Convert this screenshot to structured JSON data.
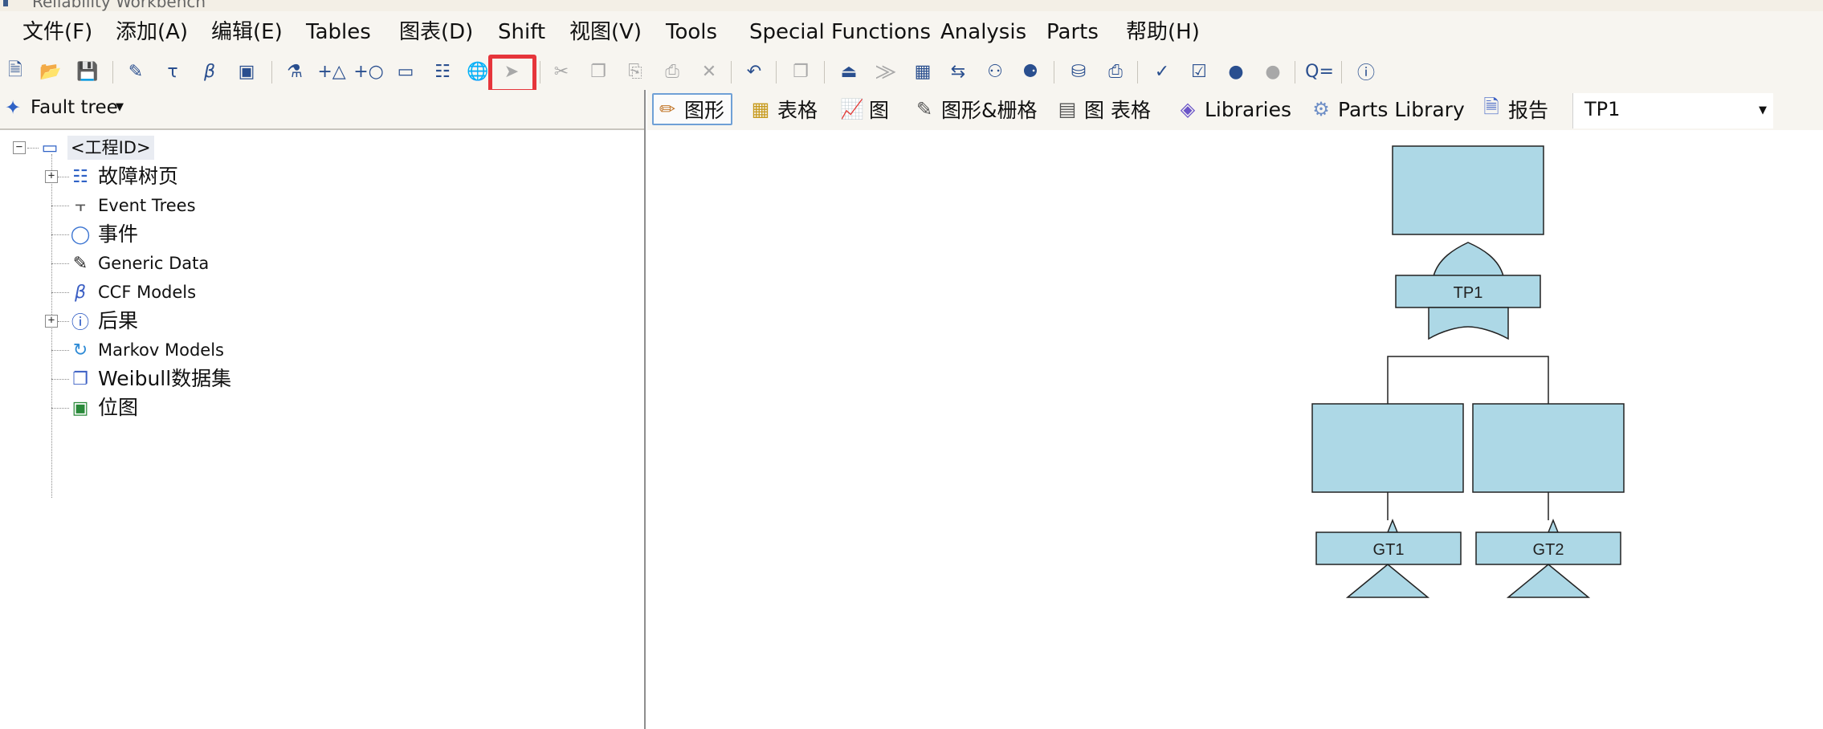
{
  "window": {
    "title": "Reliability Workbench"
  },
  "menu": [
    "文件(F)",
    "添加(A)",
    "编辑(E)",
    "Tables",
    "图表(D)",
    "Shift",
    "视图(V)",
    "Tools",
    "Special Functions",
    "Analysis",
    "Parts",
    "帮助(H)"
  ],
  "left_panel": {
    "view_selector": "Fault tree",
    "tree": [
      {
        "label": "<工程ID>"
      },
      {
        "label": "故障树页"
      },
      {
        "label": "Event Trees"
      },
      {
        "label": "事件"
      },
      {
        "label": "Generic Data"
      },
      {
        "label": "CCF Models"
      },
      {
        "label": "后果"
      },
      {
        "label": "Markov Models"
      },
      {
        "label": "Weibull数据集"
      },
      {
        "label": "位图"
      }
    ]
  },
  "right_panel": {
    "tabs": [
      "图形",
      "表格",
      "图",
      "图形&栅格",
      "图 表格",
      "Libraries",
      "Parts Library",
      "报告"
    ],
    "page_selector": "TP1"
  },
  "diagram": {
    "top_gate": {
      "label": "TP1"
    },
    "child_gates": [
      {
        "label": "GT1"
      },
      {
        "label": "GT2"
      }
    ],
    "fill": "#add8e6",
    "stroke": "#222222"
  },
  "colors": {
    "highlight": "#e6353b",
    "accent": "#2a4f8f"
  },
  "toolbar_icons": [
    "new-project-icon",
    "open-folder-icon",
    "save-icon",
    "edit-data-icon",
    "tau-icon",
    "beta-icon",
    "image-icon",
    "flask-icon",
    "add-gate-icon",
    "add-event-icon",
    "text-box-icon",
    "map-icon",
    "globe-icon",
    "pointer-arrow-icon",
    "cut-icon",
    "copy-icon",
    "paste-icon",
    "paste-special-icon",
    "delete-icon",
    "undo-icon",
    "duplicate-icon",
    "move-up-icon",
    "move-down-icon",
    "grid-icon",
    "transfer-icon",
    "binoculars-icon",
    "binoculars-find-icon",
    "database-icon",
    "report-icon",
    "spellcheck-icon",
    "clipboard-check-icon",
    "traffic-light-icon",
    "traffic-light-off-icon",
    "query-icon",
    "help-icon"
  ]
}
